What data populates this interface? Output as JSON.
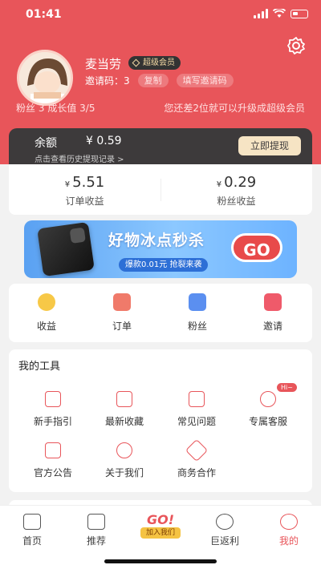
{
  "status": {
    "time": "01:41"
  },
  "profile": {
    "name": "麦当劳",
    "badge": "超级会员",
    "invite_label": "邀请码：3",
    "copy": "复制",
    "fill_invite": "填写邀请码",
    "fans": "粉丝",
    "fans_count": "3",
    "growth": "成长值",
    "growth_value": "3/5",
    "upgrade_tip": "您还差2位就可以升级成超级会员"
  },
  "balance": {
    "label": "余额",
    "amount": "¥ 0.59",
    "history": "点击查看历史提现记录 >",
    "withdraw": "立即提现"
  },
  "income": [
    {
      "currency": "¥",
      "value": "5.51",
      "label": "订单收益"
    },
    {
      "currency": "¥",
      "value": "0.29",
      "label": "粉丝收益"
    }
  ],
  "banner": {
    "title": "好物冰点秒杀",
    "sub": "爆款0.01元 抢裂来袭",
    "go": "GO"
  },
  "quick": [
    {
      "label": "收益",
      "icon": "coin-icon"
    },
    {
      "label": "订单",
      "icon": "order-icon"
    },
    {
      "label": "粉丝",
      "icon": "fans-icon"
    },
    {
      "label": "邀请",
      "icon": "invite-icon"
    }
  ],
  "tools": {
    "title": "我的工具",
    "items": [
      {
        "label": "新手指引",
        "icon": "guide-icon"
      },
      {
        "label": "最新收藏",
        "icon": "star-icon"
      },
      {
        "label": "常见问题",
        "icon": "faq-icon"
      },
      {
        "label": "专属客服",
        "icon": "headset-icon"
      },
      {
        "label": "官方公告",
        "icon": "announcement-icon"
      },
      {
        "label": "关于我们",
        "icon": "info-icon"
      },
      {
        "label": "商务合作",
        "icon": "handshake-icon"
      }
    ],
    "hi_badge": "Hi~"
  },
  "tabbar": {
    "items": [
      "首页",
      "推荐",
      "巨返利",
      "我的"
    ],
    "go": "GO!",
    "join": "加入我们"
  },
  "colors": {
    "brand": "#e8555a",
    "dark": "#3d3a3b",
    "gold": "#f6e4c4"
  }
}
